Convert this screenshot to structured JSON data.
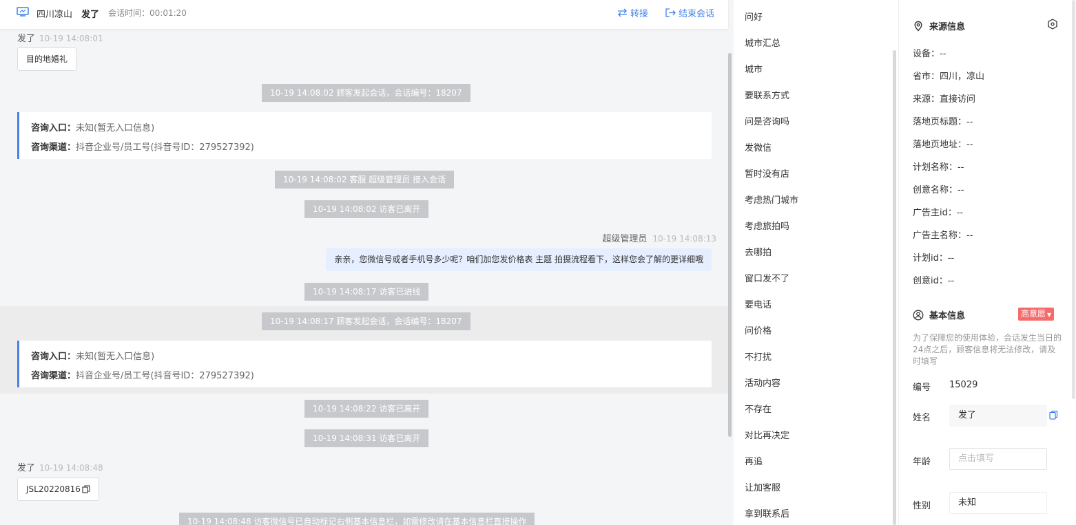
{
  "header": {
    "location": "四川凉山",
    "visitor": "发了",
    "session_time": "会话时间：00:01:20",
    "transfer": "转接",
    "end": "结束会话"
  },
  "chat": {
    "msg1": {
      "name": "发了",
      "time": "10-19 14:08:01",
      "text": "目的地婚礼"
    },
    "sys1": "10-19 14:08:02 顾客发起会话，会话编号：18207",
    "info1": {
      "entry_label": "咨询入口：",
      "entry_value": "未知(暂无入口信息)",
      "channel_label": "咨询渠道：",
      "channel_value": "抖音企业号/员工号(抖音号ID：279527392)"
    },
    "sys2": "10-19 14:08:02 客服 超级管理员 接入会话",
    "sys3": "10-19 14:08:02 访客已离开",
    "agent": {
      "name": "超级管理员",
      "time": "10-19 14:08:13",
      "text": "亲亲，您微信号或者手机号多少呢？咱们加您发价格表 主题 拍摄流程看下，这样您会了解的更详细哦"
    },
    "sys4": "10-19 14:08:17 访客已进线",
    "sys5": "10-19 14:08:17 顾客发起会话，会话编号：18207",
    "info2": {
      "entry_label": "咨询入口：",
      "entry_value": "未知(暂无入口信息)",
      "channel_label": "咨询渠道：",
      "channel_value": "抖音企业号/员工号(抖音号ID：279527392)"
    },
    "sys6": "10-19 14:08:22 访客已离开",
    "sys7": "10-19 14:08:31 访客已离开",
    "msg2": {
      "name": "发了",
      "time": "10-19 14:08:48",
      "text": "JSL20220816"
    },
    "sys8": "10-19 14:08:48 访客微信号已自动标记右侧基本信息栏，如需修改请在基本信息栏直接操作"
  },
  "phrases": [
    "问好",
    "城市汇总",
    "城市",
    "要联系方式",
    "问是咨询吗",
    "发微信",
    "暂时没有店",
    "考虑热门城市",
    "考虑旅拍吗",
    "去哪拍",
    "窗口发不了",
    "要电话",
    "问价格",
    "不打扰",
    "活动内容",
    "不存在",
    "对比再决定",
    "再追",
    "让加客服",
    "拿到联系后"
  ],
  "source": {
    "title": "来源信息",
    "rows": [
      "设备：--",
      "省市：四川，凉山",
      "来源：直接访问",
      "落地页标题：--",
      "落地页地址：--",
      "计划名称：--",
      "创意名称：--",
      "广告主id：--",
      "广告主名称：--",
      "计划id：--",
      "创意id：--"
    ]
  },
  "basic": {
    "title": "基本信息",
    "badge": "高意愿",
    "note": "为了保障您的使用体验，会话发生当日的24点之后，顾客信息将无法修改，请及时填写",
    "id_label": "编号",
    "id_value": "15029",
    "name_label": "姓名",
    "name_value": "发了",
    "age_label": "年龄",
    "age_placeholder": "点击填写",
    "gender_label": "性别",
    "gender_value": "未知"
  },
  "colors": {
    "accent": "#3d7fea",
    "badge": "#f56c6c",
    "system": "#c7c8cb"
  }
}
